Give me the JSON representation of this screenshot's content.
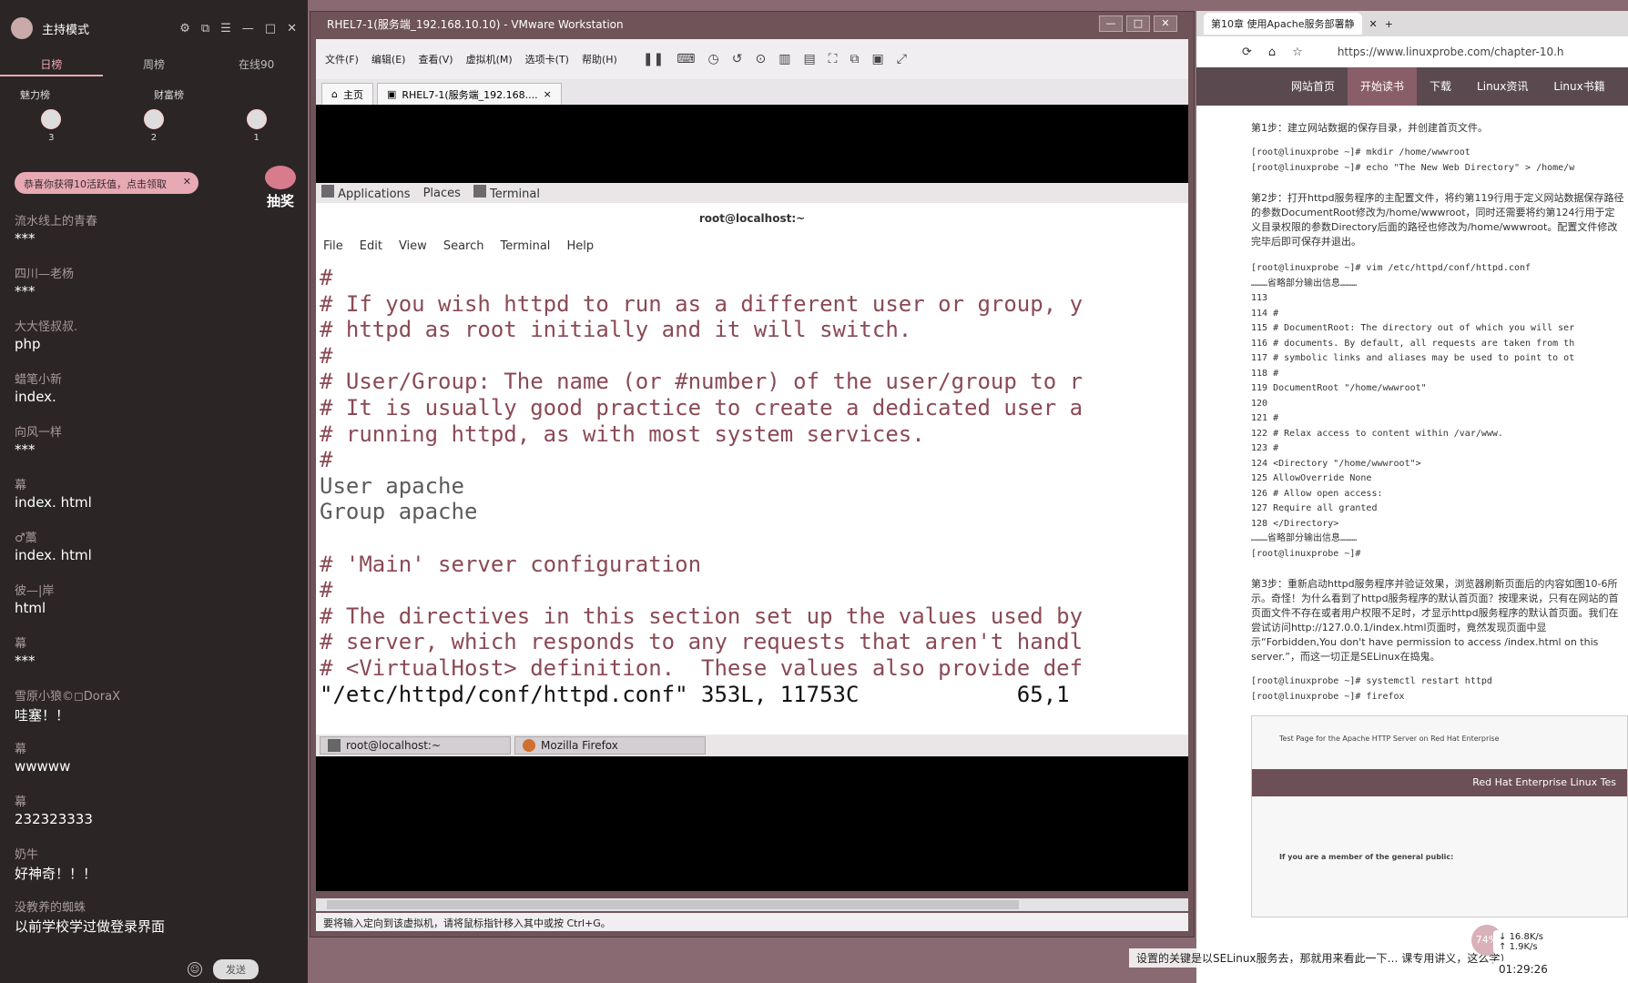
{
  "chat": {
    "mode": "主持模式",
    "tabs": [
      "日榜",
      "周榜",
      "在线90"
    ],
    "rank_left": "魅力榜",
    "rank_right": "财富榜",
    "ranks": [
      "3",
      "2",
      "1"
    ],
    "notice": "恭喜你获得10活跃值，点击领取",
    "lottery": "抽奖",
    "messages": [
      {
        "user": "流水线上的青春",
        "text": "***"
      },
      {
        "user": "四川—老杨",
        "text": "***"
      },
      {
        "user": "大大怪叔叔.",
        "text": "php"
      },
      {
        "user": "蜡笔小新",
        "text": "index."
      },
      {
        "user": "向风一样",
        "text": "***"
      },
      {
        "user": "幕",
        "text": "index.   html"
      },
      {
        "user": "♂藁",
        "text": "index. html"
      },
      {
        "user": "彼—|岸",
        "text": "html"
      },
      {
        "user": "幕",
        "text": "***"
      },
      {
        "user": "雪原小狼©◻DoraX",
        "text": "哇塞！！"
      },
      {
        "user": "幕",
        "text": "wwwww"
      },
      {
        "user": "幕",
        "text": "232323333"
      },
      {
        "user": "奶牛",
        "text": "好神奇！！！"
      },
      {
        "user": "没教养的蜘蛛",
        "text": "以前学校学过做登录界面"
      }
    ],
    "send": "发送"
  },
  "vmware": {
    "title": "RHEL7-1(服务端_192.168.10.10) - VMware Workstation",
    "menus": [
      "文件(F)",
      "编辑(E)",
      "查看(V)",
      "虚拟机(M)",
      "选项卡(T)",
      "帮助(H)"
    ],
    "tabs": [
      "主页",
      "RHEL7-1(服务端_192.168...."
    ],
    "status": "要将输入定向到该虚拟机，请将鼠标指针移入其中或按 Ctrl+G。",
    "guest": {
      "topbar": [
        "Applications",
        "Places",
        "Terminal"
      ],
      "term_title": "root@localhost:~",
      "term_menu": [
        "File",
        "Edit",
        "View",
        "Search",
        "Terminal",
        "Help"
      ],
      "lines": [
        "#",
        "# If you wish httpd to run as a different user or group, y",
        "# httpd as root initially and it will switch.",
        "#",
        "# User/Group: The name (or #number) of the user/group to r",
        "# It is usually good practice to create a dedicated user a",
        "# running httpd, as with most system services.",
        "#",
        "User apache",
        "Group apache",
        "",
        "# 'Main' server configuration",
        "#",
        "# The directives in this section set up the values used by",
        "# server, which responds to any requests that aren't handl",
        "# <VirtualHost> definition.  These values also provide def",
        "\"/etc/httpd/conf/httpd.conf\" 353L, 11753C            65,1"
      ],
      "taskbar": [
        "root@localhost:~",
        "Mozilla Firefox"
      ]
    }
  },
  "browser": {
    "tab": "第10章 使用Apache服务部署静",
    "url": "https://www.linuxprobe.com/chapter-10.h",
    "nav": [
      "网站首页",
      "开始读书",
      "下载",
      "Linux资讯",
      "Linux书籍"
    ],
    "step1": "第1步：建立网站数据的保存目录，并创建首页文件。",
    "code1": "[root@linuxprobe ~]# mkdir /home/wwwroot\n[root@linuxprobe ~]# echo \"The New Web Directory\" > /home/w",
    "step2": "第2步：打开httpd服务程序的主配置文件，将约第119行用于定义网站数据保存路径的参数DocumentRoot修改为/home/wwwroot，同时还需要将约第124行用于定义目录权限的参数Directory后面的路径也修改为/home/wwwroot。配置文件修改完毕后即可保存并退出。",
    "code2": "[root@linuxprobe ~]# vim /etc/httpd/conf/httpd.conf\n………省略部分输出信息………\n113\n114 #\n115 # DocumentRoot: The directory out of which you will ser\n116 # documents. By default, all requests are taken from th\n117 # symbolic links and aliases may be used to point to ot\n118 #\n119 DocumentRoot \"/home/wwwroot\"\n120\n121 #\n122 # Relax access to content within /var/www.\n123 #\n124 <Directory \"/home/wwwroot\">\n125 AllowOverride None\n126 # Allow open access:\n127 Require all granted\n128 </Directory>\n………省略部分输出信息………\n[root@linuxprobe ~]#",
    "step3": "第3步：重新启动httpd服务程序并验证效果，浏览器刷新页面后的内容如图10-6所示。奇怪！为什么看到了httpd服务程序的默认首页面？按理来说，只有在网站的首页面文件不存在或者用户权限不足时，才显示httpd服务程序的默认首页面。我们在尝试访问http://127.0.0.1/index.html页面时，竟然发现页面中显示“Forbidden,You don't have permission to access /index.html on this server.”，而这一切正是SELinux在捣鬼。",
    "code3": "[root@linuxprobe ~]# systemctl restart httpd\n[root@linuxprobe ~]# firefox",
    "mini_banner": "Red Hat Enterprise Linux Tes",
    "mini_public": "If you are a member of the general public:",
    "mini_title": "Test Page for the Apache HTTP Server on Red Hat Enterprise"
  },
  "overlays": {
    "caption": "课专用讲义，这么学）",
    "caption2": "设置的关键是以SELinux服务去，那就用来看此一下…",
    "cpu": "74%",
    "down": "16.8K/s",
    "up": "1.9K/s",
    "clock": "01:29:26"
  }
}
